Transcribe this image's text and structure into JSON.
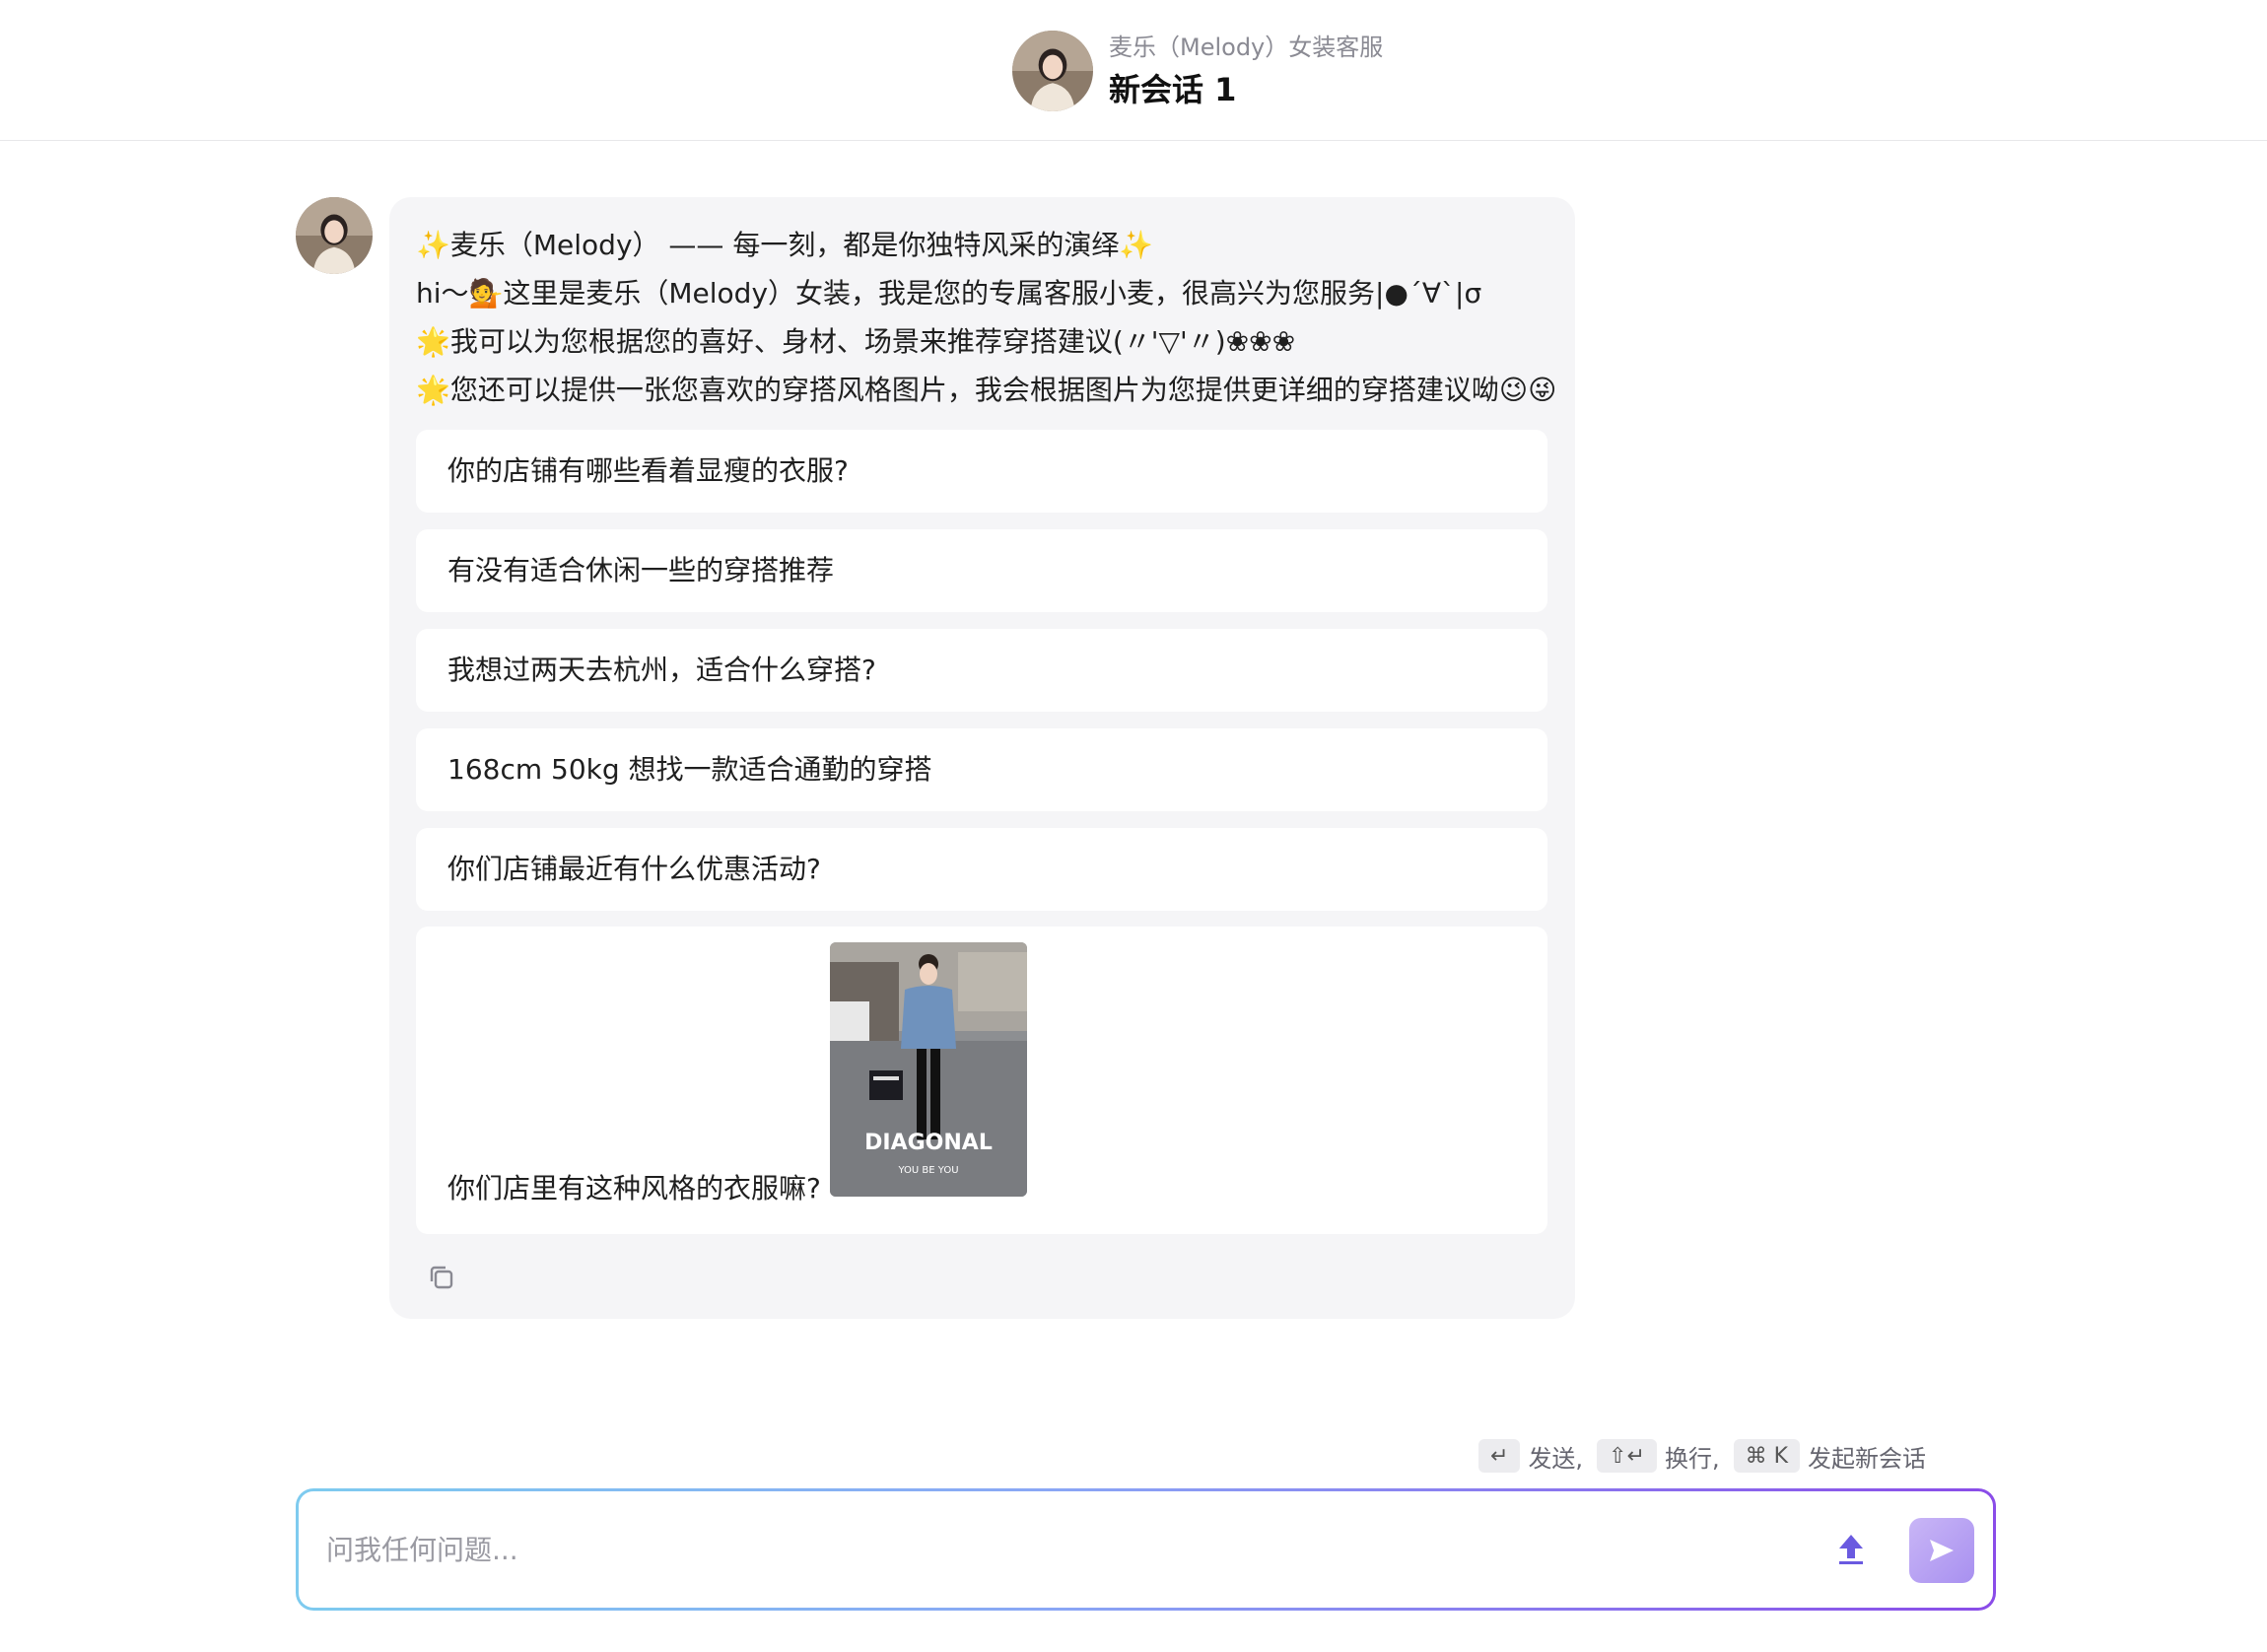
{
  "header": {
    "subtitle": "麦乐（Melody）女装客服",
    "title": "新会话 1",
    "avatar_icon": "assistant-avatar"
  },
  "message": {
    "intro_lines": [
      "麦乐（Melody） —— 每一刻，都是你独特风采的演绎",
      "hi～💁这里是麦乐（Melody）女装，我是您的专属客服小麦，很高兴为您服务|●´∀`|σ",
      "我可以为您根据您的喜好、身材、场景来推荐穿搭建议(〃'▽'〃)❀❀❀",
      "您还可以提供一张您喜欢的穿搭风格图片，我会根据图片为您提供更详细的穿搭建议呦😉😜"
    ],
    "suggestions": [
      "你的店铺有哪些看着显瘦的衣服?",
      "有没有适合休闲一些的穿搭推荐",
      "我想过两天去杭州，适合什么穿搭?",
      "168cm 50kg 想找一款适合通勤的穿搭",
      "你们店铺最近有什么优惠活动?"
    ],
    "image_suggestion": {
      "text": "你们店里有这种风格的衣服嘛?",
      "photo_caption": "DIAGONAL",
      "photo_subcaption": "YOU BE YOU"
    },
    "copy_icon": "copy-icon"
  },
  "hints": {
    "send_key": "↵",
    "send_label": "发送,",
    "newline_key": "⇧↵",
    "newline_label": "换行,",
    "new_chat_key": "⌘ K",
    "new_chat_label": "发起新会话"
  },
  "input": {
    "placeholder": "问我任何问题...",
    "value": "",
    "upload_icon": "upload-icon",
    "send_icon": "send-icon"
  },
  "colors": {
    "accent_purple": "#8a4ce8",
    "accent_blue": "#7ecbef",
    "bubble_bg": "#f5f5f7"
  }
}
